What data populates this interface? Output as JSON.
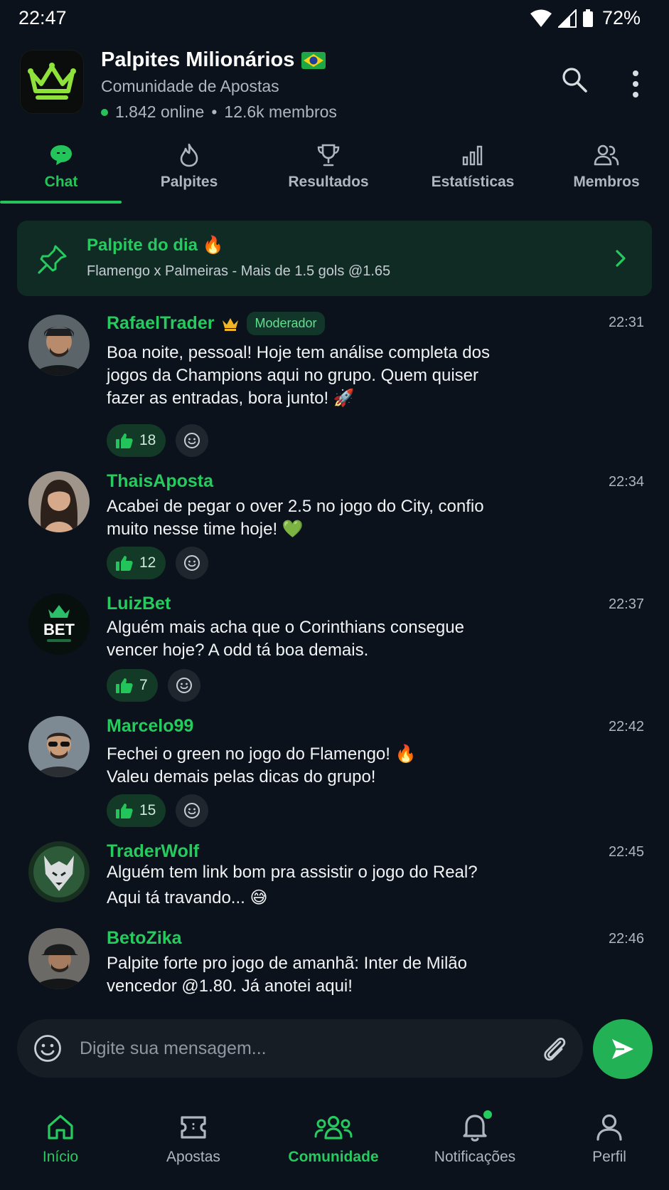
{
  "status_bar": {
    "time": "22:47",
    "battery": "72%"
  },
  "header": {
    "title": "Palpites Milionários",
    "subtitle": "Comunidade de Apostas",
    "online": "1.842 online",
    "members": "12.6k membros",
    "accent": "#23c45a"
  },
  "tabs": [
    {
      "label": "Chat",
      "icon": "chat-bubble-icon",
      "active": true
    },
    {
      "label": "Palpites",
      "icon": "flame-icon"
    },
    {
      "label": "Resultados",
      "icon": "trophy-icon"
    },
    {
      "label": "Estatísticas",
      "icon": "bar-chart-icon"
    },
    {
      "label": "Membros",
      "icon": "users-icon"
    }
  ],
  "pinned": {
    "title": "Palpite do dia",
    "text": "Flamengo x Palmeiras - Mais de 1.5 gols @1.65"
  },
  "messages": [
    {
      "name": "RafaelTrader",
      "badge": "Moderador",
      "time": "22:31",
      "line1": "Boa noite, pessoal! Hoje tem análise completa dos",
      "line2": "jogos da Champions aqui no grupo. Quem quiser",
      "line3": "fazer as entradas, bora junto!",
      "likes": "18"
    },
    {
      "name": "ThaisAposta",
      "time": "22:34",
      "line1": "Acabei de pegar o over 2.5 no jogo do City, confio",
      "line2": "muito nesse time hoje!",
      "likes": "12"
    },
    {
      "name": "LuizBet",
      "time": "22:37",
      "line1": "Alguém mais acha que o Corinthians consegue",
      "line2": "vencer hoje? A odd tá boa demais.",
      "likes": "7",
      "avatar_text": "BET"
    },
    {
      "name": "Marcelo99",
      "time": "22:42",
      "line1": "Fechei o green no jogo do Flamengo!",
      "line2": "Valeu demais pelas dicas do grupo!",
      "likes": "15"
    },
    {
      "name": "TraderWolf",
      "time": "22:45",
      "line1": "Alguém tem link bom pra assistir o jogo do Real?",
      "line2": "Aqui tá travando..."
    },
    {
      "name": "BetoZika",
      "time": "22:46",
      "line1": "Palpite forte pro jogo de amanhã: Inter de Milão",
      "line2": "vencedor @1.80. Já anotei aqui!"
    }
  ],
  "composer": {
    "placeholder": "Digite sua mensagem..."
  },
  "bottom_nav": [
    {
      "label": "Início",
      "icon": "home-icon"
    },
    {
      "label": "Apostas",
      "icon": "ticket-icon"
    },
    {
      "label": "Comunidade",
      "icon": "community-icon",
      "active": true
    },
    {
      "label": "Notificações",
      "icon": "bell-icon"
    },
    {
      "label": "Perfil",
      "icon": "profile-icon"
    }
  ]
}
